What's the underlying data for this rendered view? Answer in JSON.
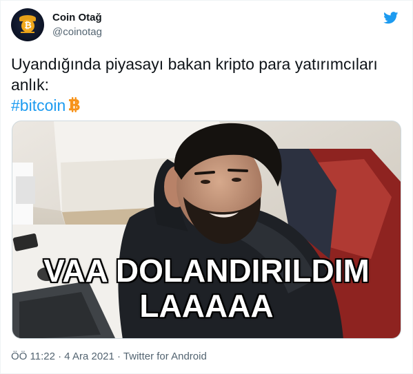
{
  "author": {
    "display_name": "Coin Otağ",
    "handle": "@coinotag",
    "avatar_icon": "bitcoin-mascot-avatar"
  },
  "tweet": {
    "text_line1": "Uyandığında piyasayı bakan kripto para yatırımcıları",
    "text_line2": "anlık:",
    "hashtag": "#bitcoin",
    "hashtag_emoji_icon": "bitcoin-sign-icon"
  },
  "media": {
    "caption_line1": "VAA DOLANDIRILDIM",
    "caption_line2": "LAAAAA"
  },
  "footer": {
    "time": "ÖÖ 11:22",
    "separator1": " · ",
    "date": "4 Ara 2021",
    "separator2": " · ",
    "source": "Twitter for Android"
  },
  "colors": {
    "hashtag": "#1d9bf0",
    "bitcoin_orange": "#f7931a",
    "secondary_text": "#536471",
    "twitter_blue": "#1d9bf0"
  }
}
